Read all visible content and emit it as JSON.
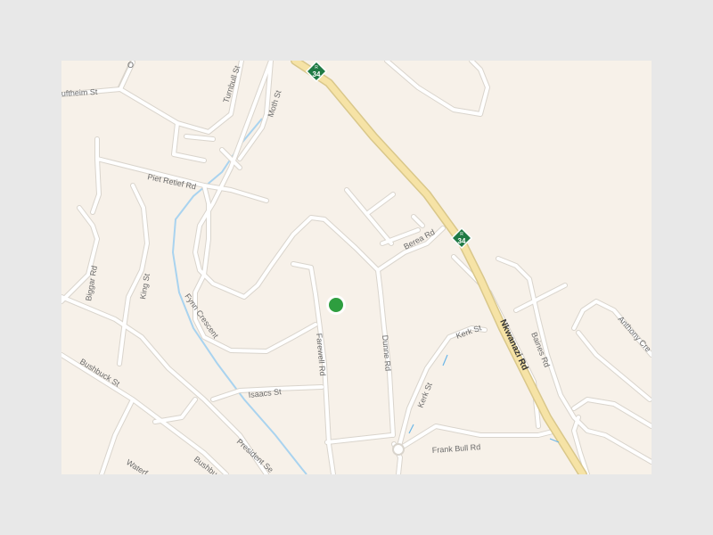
{
  "map": {
    "colors": {
      "land": "#f7f1e9",
      "frame_background": "#e8e8e8",
      "minor_road": "#ffffff",
      "major_road": "#f6e3a6",
      "major_road_outline": "#d9c78a",
      "river": "#a9d3ef",
      "location_marker": "#2e9e3f",
      "shield": "#1f7a44"
    },
    "route_shield": {
      "letter": "R",
      "number": "34"
    },
    "streets": {
      "nkwanazi": "Nkwanazi Rd",
      "piet_retief": "Piet Retief Rd",
      "berea": "Berea Rd",
      "fynn": "Fynn Crescent",
      "farewell": "Farewell Rd",
      "dunne": "Dunne Rd",
      "isaacs": "Isaacs St",
      "kerk_1": "Kerk St",
      "kerk_2": "Kerk St",
      "frank_bull": "Frank Bull Rd",
      "biggar": "Biggar Rd",
      "king": "King St",
      "bushbuck": "Bushbuck St",
      "bushbuck_2": "Bushbu",
      "president": "President Se",
      "turnbull": "Turnbull St",
      "moth": "Moth St",
      "uftheim": "uftheim St",
      "baines": "Baines Rd",
      "anthony": "Anthony Cre",
      "waterf": "Waterf",
      "o_partial": "O"
    },
    "marker_icon": "green-location-dot"
  }
}
